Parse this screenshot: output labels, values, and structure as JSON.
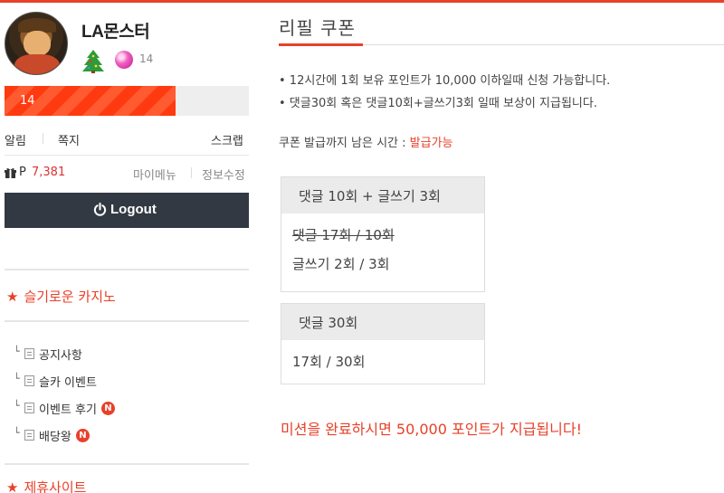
{
  "colors": {
    "accent": "#e8412a",
    "logout_bg": "#323943",
    "level_bar": "#ff3a10"
  },
  "profile": {
    "username": "LA몬스터",
    "level_small": "14",
    "level_bar_label": "14",
    "level_progress": 0.7,
    "icons": [
      "christmas-tree-icon",
      "pink-orb-icon"
    ]
  },
  "quick_links": {
    "alarm": "알림",
    "memo": "쪽지",
    "scrap": "스크랩"
  },
  "points": {
    "label": "P",
    "value": "7,381",
    "mymenu": "마이메뉴",
    "edit_info": "정보수정"
  },
  "logout_label": "Logout",
  "sidebar": {
    "section1_title": "슬기로운 카지노",
    "boards": [
      {
        "label": "공지사항",
        "new": false
      },
      {
        "label": "슬카 이벤트",
        "new": false
      },
      {
        "label": "이벤트 후기",
        "new": true
      },
      {
        "label": "배당왕",
        "new": true
      }
    ],
    "new_badge": "N",
    "section2_title": "제휴사이트"
  },
  "main": {
    "title": "리필 쿠폰",
    "notices": [
      "• 12시간에 1회 보유 포인트가 10,000 이하일때 신청 가능합니다.",
      "• 댓글30회 혹은 댓글10회+글쓰기3회 일때 보상이 지급됩니다."
    ],
    "timer_label": "쿠폰 발급까지 남은 시간 : ",
    "timer_value": "발급가능",
    "mission1": {
      "header": "댓글 10회 + 글쓰기 3회",
      "line1": "댓글 17회 / 10회",
      "line2": "글쓰기 2회 / 3회"
    },
    "mission2": {
      "header": "댓글 30회",
      "line1": "17회 / 30회"
    },
    "complete_message": "미션을 완료하시면 50,000 포인트가 지급됩니다!"
  }
}
